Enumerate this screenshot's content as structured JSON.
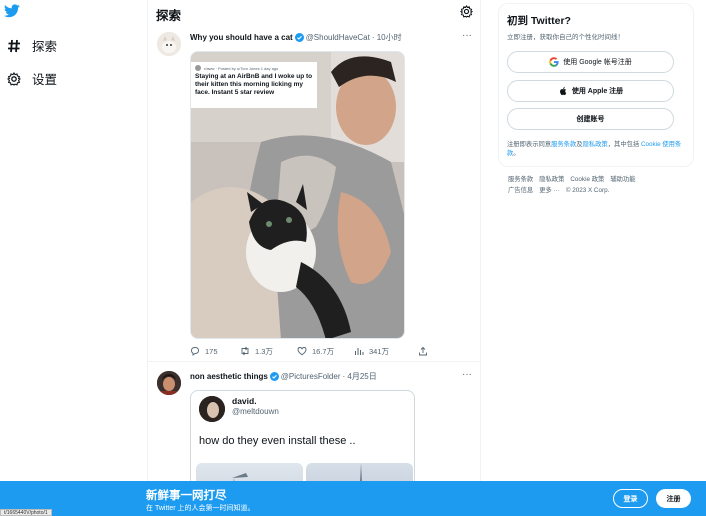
{
  "nav": {
    "explore_label": "探索",
    "settings_label": "设置"
  },
  "header": {
    "title": "探索"
  },
  "tweet1": {
    "name": "Why you should have a cat",
    "handle": "@ShouldHaveCat",
    "time": "· 10小时",
    "more": "···",
    "embed_user": "r/aww · Posted by u/Tom Jones 1 day ago",
    "embed_text": "Staying at an AirBnB and I woke up to their kitten this morning licking my face. Instant 5 star review",
    "replies": "175",
    "retweets": "1.3万",
    "likes": "16.7万",
    "views": "341万"
  },
  "tweet2": {
    "name": "non aesthetic things",
    "handle": "@PicturesFolder",
    "time": "· 4月25日",
    "more": "···",
    "quote_name": "david.",
    "quote_handle": "@meltdouwn",
    "quote_text": "how do they even install these .."
  },
  "signup": {
    "title": "初到 Twitter?",
    "subtitle": "立即注册，获取你自己的个性化时间线！",
    "google_label": "使用 Google 帐号注册",
    "apple_label": "使用 Apple 注册",
    "create_label": "创建账号",
    "terms_prefix": "注册即表示同意",
    "terms_link1": "服务条款",
    "terms_and": "及",
    "terms_link2": "隐私政策",
    "terms_mid": "，其中包括 ",
    "terms_link3": "Cookie 使用条款",
    "terms_end": "。"
  },
  "footer": {
    "links": [
      "服务条款",
      "隐私政策",
      "Cookie 政策",
      "辅助功能",
      "广告信息",
      "更多 ···",
      "© 2023 X Corp."
    ]
  },
  "bottombar": {
    "title": "新鲜事一网打尽",
    "subtitle": "在 Twitter 上的人会第一时间知道。",
    "login_label": "登录",
    "signup_label": "注册"
  },
  "status_url": "t/1665440V/photo/1",
  "colors": {
    "accent": "#1d9bf0",
    "text": "#0f1419",
    "muted": "#536471"
  }
}
